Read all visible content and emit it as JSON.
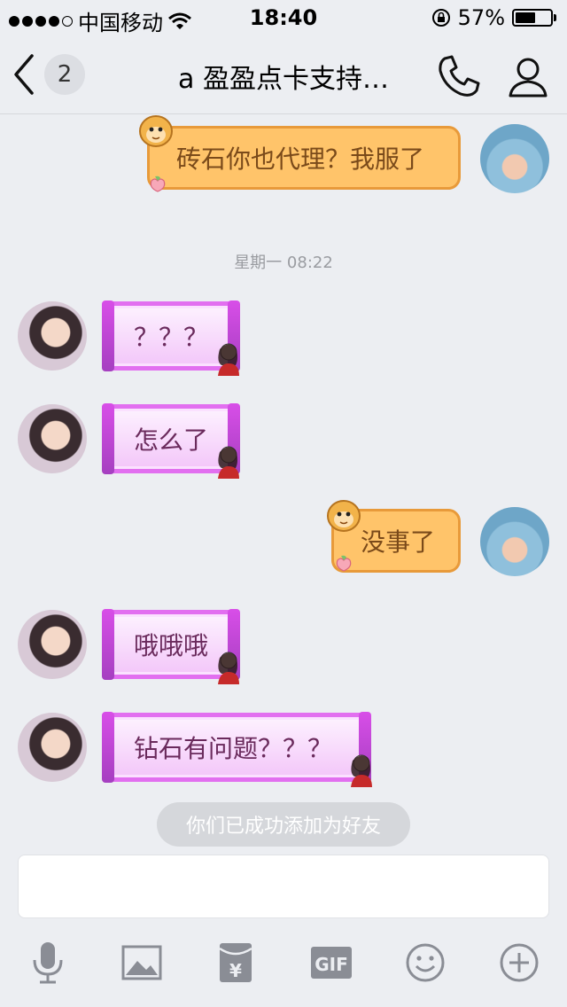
{
  "status_bar": {
    "carrier": "中国移动",
    "time": "18:40",
    "battery_percent": "57%",
    "battery_level": 0.57
  },
  "nav": {
    "back_count": "2",
    "title": "a 盈盈点卡支持…"
  },
  "timestamp": "星期一 08:22",
  "messages": [
    {
      "side": "right",
      "text": "砖石你也代理？我服了"
    },
    {
      "side": "left",
      "text": "？？？"
    },
    {
      "side": "left",
      "text": "怎么了"
    },
    {
      "side": "right",
      "text": "没事了"
    },
    {
      "side": "left",
      "text": "哦哦哦"
    },
    {
      "side": "left",
      "text": "钻石有问题？？？"
    }
  ],
  "system_notice": "你们已成功添加为好友",
  "input": {
    "value": "",
    "placeholder": ""
  },
  "toolbar": {
    "items": [
      "mic-icon",
      "image-icon",
      "red-packet-icon",
      "gif-icon",
      "emoji-icon",
      "plus-icon"
    ],
    "gif_label": "GIF",
    "red_packet_label": "¥"
  },
  "colors": {
    "background": "#eceef2",
    "girl_bubble_border": "#e26ff0",
    "monkey_bubble": "#ffc46a"
  }
}
